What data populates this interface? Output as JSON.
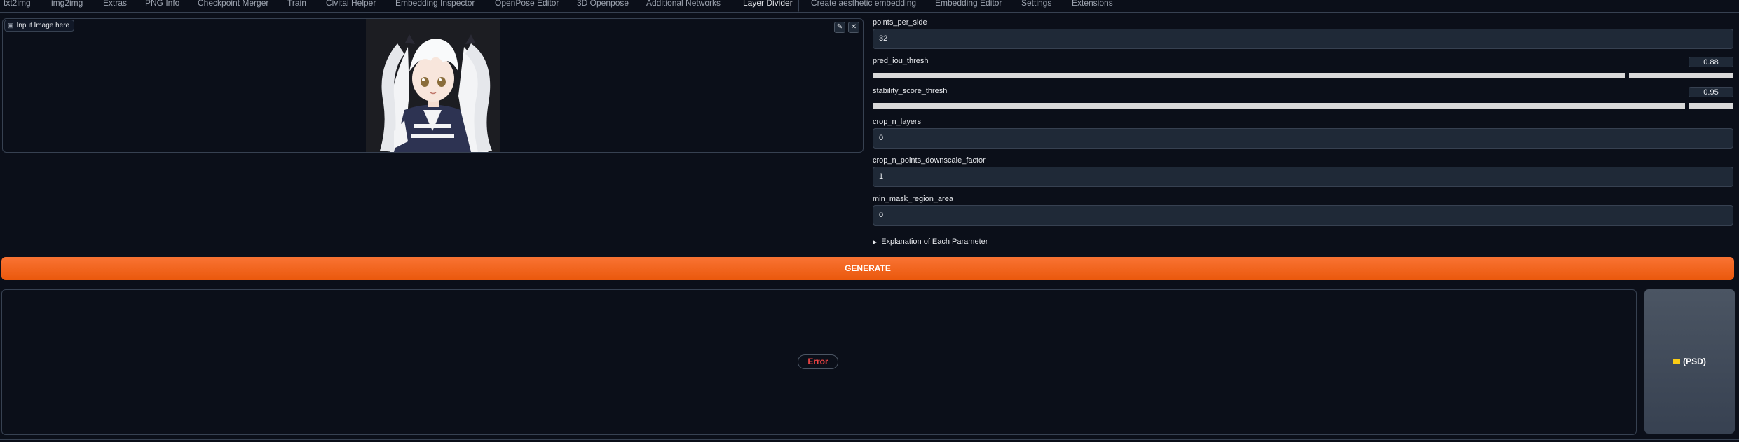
{
  "tabs": [
    {
      "label": "txt2img"
    },
    {
      "label": "img2img"
    },
    {
      "label": "Extras"
    },
    {
      "label": "PNG Info"
    },
    {
      "label": "Checkpoint Merger"
    },
    {
      "label": "Train"
    },
    {
      "label": "Civitai Helper"
    },
    {
      "label": "Embedding Inspector"
    },
    {
      "label": "OpenPose Editor"
    },
    {
      "label": "3D Openpose"
    },
    {
      "label": "Additional Networks"
    },
    {
      "label": "Layer Divider"
    },
    {
      "label": "Create aesthetic embedding"
    },
    {
      "label": "Embedding Editor"
    },
    {
      "label": "Settings"
    },
    {
      "label": "Extensions"
    }
  ],
  "active_tab": "Layer Divider",
  "input_image": {
    "label": "Input Image here",
    "edit_icon": "pencil-icon",
    "close_icon": "close-icon"
  },
  "params": {
    "points_per_side": {
      "label": "points_per_side",
      "value": "32"
    },
    "pred_iou_thresh": {
      "label": "pred_iou_thresh",
      "value": "0.88"
    },
    "stability_score_thresh": {
      "label": "stability_score_thresh",
      "value": "0.95"
    },
    "crop_n_layers": {
      "label": "crop_n_layers",
      "value": "0"
    },
    "crop_n_points_downscale_factor": {
      "label": "crop_n_points_downscale_factor",
      "value": "1"
    },
    "min_mask_region_area": {
      "label": "min_mask_region_area",
      "value": "0"
    }
  },
  "explanation_label": "Explanation of Each Parameter",
  "generate_label": "GENERATE",
  "output": {
    "status": "Error"
  },
  "psd_button": {
    "label": "(PSD)",
    "icon": "folder-icon"
  },
  "colors": {
    "accent": "#ea580c",
    "error": "#ef4444",
    "background": "#0b0f19"
  }
}
